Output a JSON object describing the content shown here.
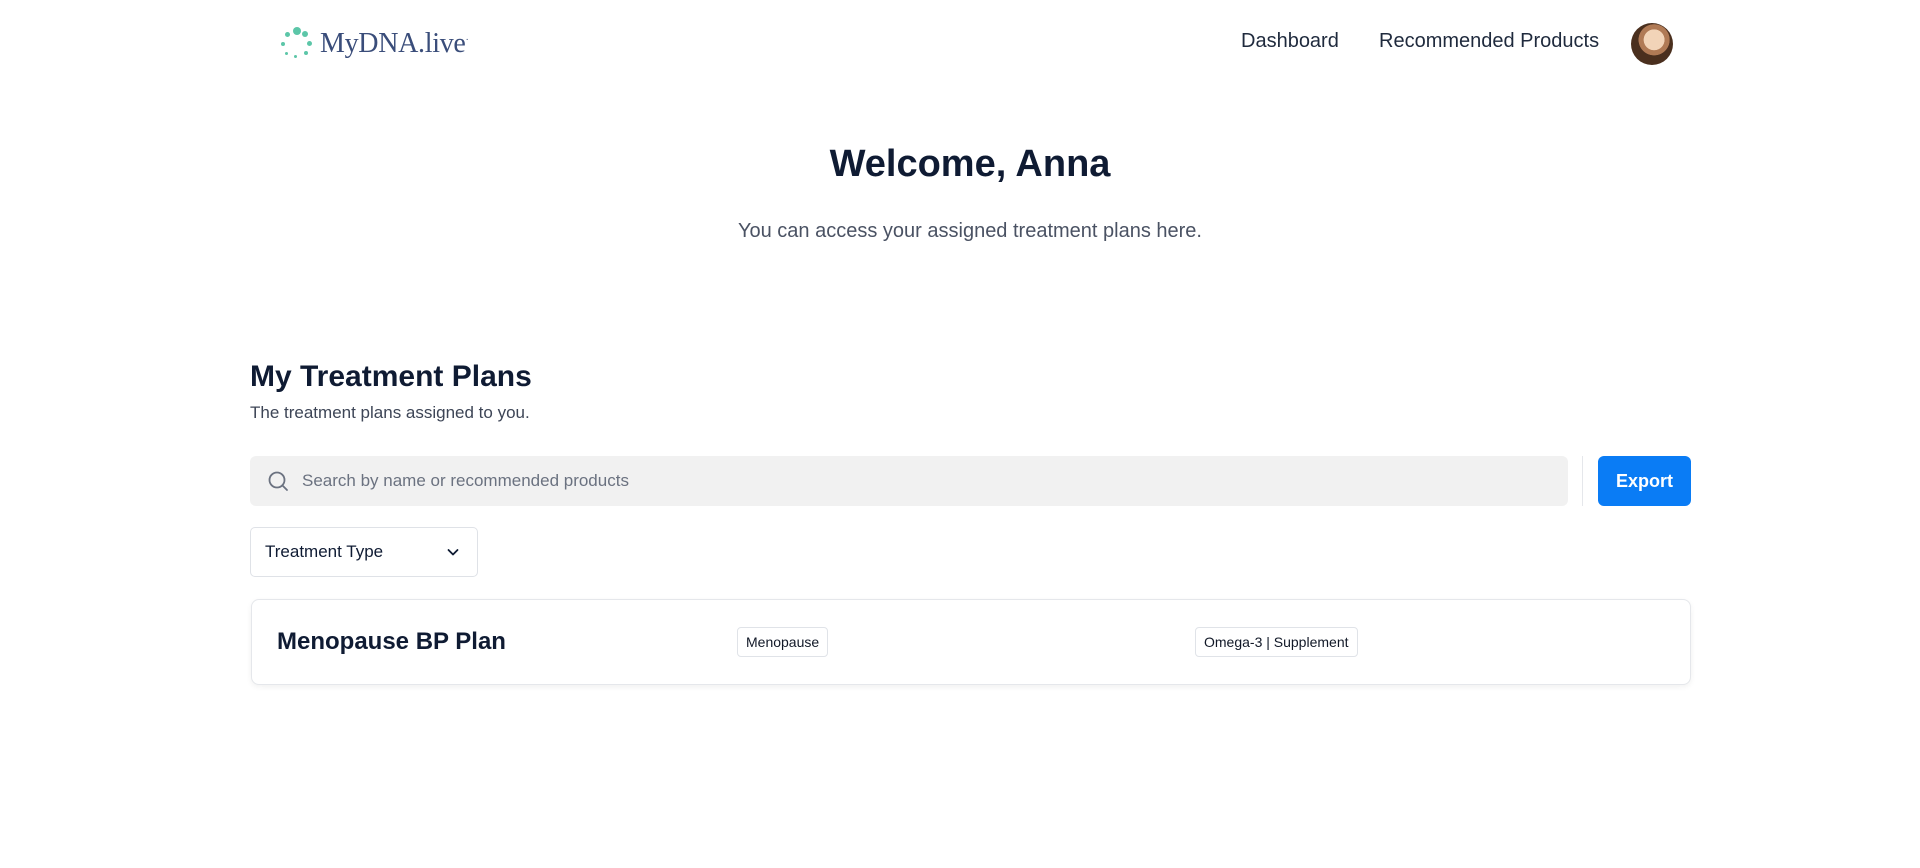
{
  "brand": {
    "name": "MyDNA.live",
    "name_main": "MyDNA.live",
    "trademark": "·",
    "accent": "#5cc6a8",
    "text_color": "#3a4d7a"
  },
  "nav": {
    "dashboard": "Dashboard",
    "recommended_products": "Recommended Products"
  },
  "hero": {
    "title": "Welcome, Anna",
    "subtitle": "You can access your assigned treatment plans here."
  },
  "plans": {
    "title": "My Treatment Plans",
    "subtitle": "The treatment plans assigned to you.",
    "search_placeholder": "Search by name or recommended products",
    "search_value": "",
    "export_label": "Export",
    "filter_label": "Treatment Type",
    "items": [
      {
        "name": "Menopause BP Plan",
        "type": "Menopause",
        "products": "Omega-3 | Supplement"
      }
    ]
  },
  "colors": {
    "primary_button": "#0a7cf5",
    "heading": "#0f1b33"
  },
  "icons": {
    "search": "search-icon",
    "dropdown": "chevron-down-icon",
    "avatar": "user-avatar"
  }
}
